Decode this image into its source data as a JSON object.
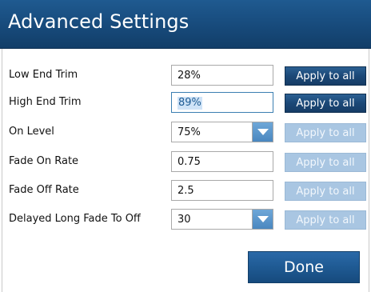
{
  "dialog": {
    "title": "Advanced Settings",
    "done_label": "Done"
  },
  "settings": [
    {
      "label": "Low End Trim",
      "value": "28%",
      "control": "text",
      "apply_label": "Apply to all",
      "apply_enabled": true
    },
    {
      "label": "High End Trim",
      "value": "89%",
      "control": "text",
      "apply_label": "Apply to all",
      "apply_enabled": true,
      "focused": true,
      "selected_text": true
    },
    {
      "label": "On Level",
      "value": "75%",
      "control": "dropdown",
      "apply_label": "Apply to all",
      "apply_enabled": false
    },
    {
      "label": "Fade On Rate",
      "value": "0.75",
      "control": "text",
      "apply_label": "Apply to all",
      "apply_enabled": false
    },
    {
      "label": "Fade Off Rate",
      "value": "2.5",
      "control": "text",
      "apply_label": "Apply to all",
      "apply_enabled": false
    },
    {
      "label": "Delayed Long Fade To Off",
      "value": "30",
      "control": "dropdown",
      "apply_label": "Apply to all",
      "apply_enabled": false
    }
  ],
  "colors": {
    "title_bar": "#174a7b",
    "apply_enabled": "#1b4877",
    "apply_disabled": "#a9c6e2",
    "done_button": "#1f5a93",
    "dropdown_arrow": "#4a87c0"
  },
  "icons": {
    "dropdown": "chevron-down-icon"
  }
}
